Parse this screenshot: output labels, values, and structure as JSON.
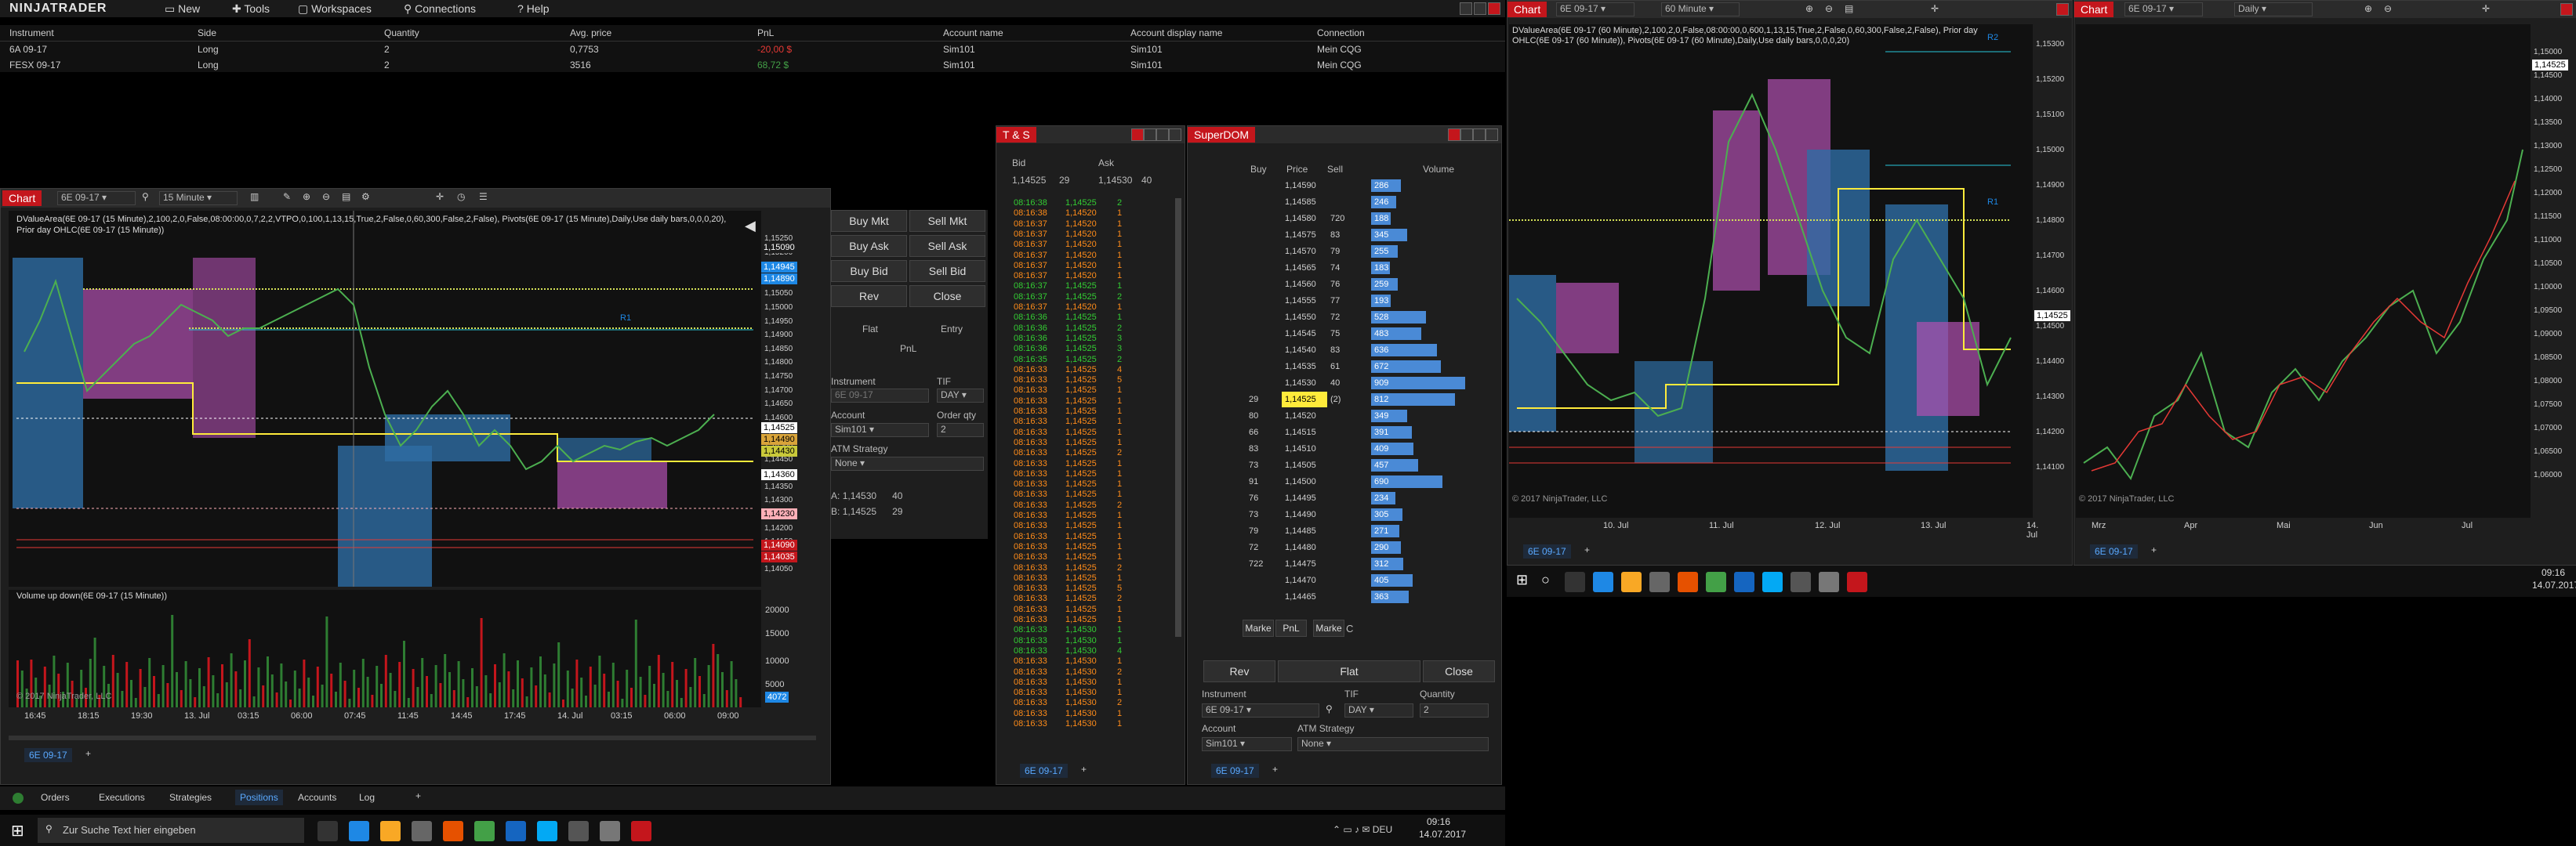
{
  "menubar": {
    "logo": "NINJATRADER",
    "items": [
      "New",
      "Tools",
      "Workspaces",
      "Connections",
      "Help"
    ]
  },
  "positions": {
    "headers": [
      "Instrument",
      "Side",
      "Quantity",
      "Avg. price",
      "PnL",
      "Account name",
      "Account display name",
      "Connection"
    ],
    "rows": [
      {
        "instrument": "6A 09-17",
        "side": "Long",
        "qty": "2",
        "avg": "0,7753",
        "pnl": "-20,00 $",
        "account": "Sim101",
        "display": "Sim101",
        "conn": "Mein CQG"
      },
      {
        "instrument": "FESX 09-17",
        "side": "Long",
        "qty": "2",
        "avg": "3516",
        "pnl": "68,72 $",
        "account": "Sim101",
        "display": "Sim101",
        "conn": "Mein CQG"
      }
    ]
  },
  "chart1": {
    "tab": "Chart",
    "instrument": "6E 09-17",
    "interval": "15 Minute",
    "info": "DValueArea(6E 09-17 (15 Minute),2,100,2,0,False,08:00:00,0,7,2,2,VTPO,0,100,1,13,15,True,2,False,0,60,300,False,2,False), Pivots(6E 09-17 (15 Minute),Daily,Use daily bars,0,0,0,20), Prior day OHLC(6E 09-17 (15 Minute))",
    "prices": [
      "1,15250",
      "1,15200",
      "1,15150",
      "1,15100",
      "1,15050",
      "1,15000",
      "1,14950",
      "1,14900",
      "1,14850",
      "1,14800",
      "1,14750",
      "1,14700",
      "1,14650",
      "1,14600",
      "1,14550",
      "1,14500",
      "1,14450",
      "1,14400",
      "1,14350",
      "1,14300",
      "1,14250",
      "1,14200",
      "1,14150",
      "1,14100",
      "1,14050"
    ],
    "tags": [
      {
        "text": "1,15090",
        "color": "#ffffff",
        "bg": "#1e1e1e"
      },
      {
        "text": "1,14945",
        "color": "#ffffff",
        "bg": "#1e88e5"
      },
      {
        "text": "1,14890",
        "color": "#ffffff",
        "bg": "#1e88e5"
      },
      {
        "text": "1,14525",
        "color": "#000000",
        "bg": "#ffffff"
      },
      {
        "text": "1,14490",
        "color": "#000000",
        "bg": "#d9a43a"
      },
      {
        "text": "1,14430",
        "color": "#000000",
        "bg": "#c9c93a"
      },
      {
        "text": "1,14360",
        "color": "#000000",
        "bg": "#ffffff"
      },
      {
        "text": "1,14230",
        "color": "#000000",
        "bg": "#ffb0b8"
      },
      {
        "text": "1,14090",
        "color": "#ffffff",
        "bg": "#c4161c"
      },
      {
        "text": "1,14035",
        "color": "#ffffff",
        "bg": "#c4161c"
      }
    ],
    "r1": "R1",
    "volume_label": "Volume up down(6E 09-17 (15 Minute))",
    "vol_ticks": [
      "20000",
      "15000",
      "10000",
      "5000"
    ],
    "vol_tag": "4072",
    "copyright": "© 2017 NinjaTrader, LLC",
    "xlabels": [
      "16:45",
      "18:15",
      "19:30",
      "13. Jul",
      "03:15",
      "06:00",
      "07:45",
      "11:45",
      "14:45",
      "17:45",
      "14. Jul",
      "03:15",
      "06:00",
      "09:00"
    ],
    "footer_tab": "6E 09-17"
  },
  "chart_trader": {
    "buttons": [
      "Buy Mkt",
      "Sell Mkt",
      "Buy Ask",
      "Sell Ask",
      "Buy Bid",
      "Sell Bid",
      "Rev",
      "Close"
    ],
    "flat": "Flat",
    "entry": "Entry",
    "pnl": "PnL",
    "instrument_label": "Instrument",
    "instrument": "6E 09-17",
    "tif_label": "TIF",
    "tif": "DAY",
    "account_label": "Account",
    "account": "Sim101",
    "qty_label": "Order qty",
    "qty": "2",
    "atm_label": "ATM Strategy",
    "atm": "None",
    "a_line": {
      "k": "A:",
      "p": "1,14530",
      "q": "40"
    },
    "b_line": {
      "k": "B:",
      "p": "1,14525",
      "q": "29"
    }
  },
  "ts": {
    "title": "T & S",
    "bid_label": "Bid",
    "ask_label": "Ask",
    "bid": "1,14525",
    "bidq": "29",
    "ask": "1,14530",
    "askq": "40",
    "rows": [
      [
        "08:16:38",
        "1,14525",
        "2",
        "g"
      ],
      [
        "08:16:38",
        "1,14520",
        "1",
        "o"
      ],
      [
        "08:16:37",
        "1,14520",
        "1",
        "o"
      ],
      [
        "08:16:37",
        "1,14520",
        "1",
        "o"
      ],
      [
        "08:16:37",
        "1,14520",
        "1",
        "o"
      ],
      [
        "08:16:37",
        "1,14520",
        "1",
        "o"
      ],
      [
        "08:16:37",
        "1,14520",
        "1",
        "o"
      ],
      [
        "08:16:37",
        "1,14520",
        "1",
        "o"
      ],
      [
        "08:16:37",
        "1,14525",
        "1",
        "g"
      ],
      [
        "08:16:37",
        "1,14525",
        "2",
        "g"
      ],
      [
        "08:16:37",
        "1,14520",
        "1",
        "o"
      ],
      [
        "08:16:36",
        "1,14525",
        "1",
        "g"
      ],
      [
        "08:16:36",
        "1,14525",
        "2",
        "g"
      ],
      [
        "08:16:36",
        "1,14525",
        "3",
        "g"
      ],
      [
        "08:16:36",
        "1,14525",
        "3",
        "g"
      ],
      [
        "08:16:35",
        "1,14525",
        "2",
        "g"
      ],
      [
        "08:16:33",
        "1,14525",
        "4",
        "o"
      ],
      [
        "08:16:33",
        "1,14525",
        "5",
        "o"
      ],
      [
        "08:16:33",
        "1,14525",
        "1",
        "o"
      ],
      [
        "08:16:33",
        "1,14525",
        "1",
        "o"
      ],
      [
        "08:16:33",
        "1,14525",
        "1",
        "o"
      ],
      [
        "08:16:33",
        "1,14525",
        "1",
        "o"
      ],
      [
        "08:16:33",
        "1,14525",
        "1",
        "o"
      ],
      [
        "08:16:33",
        "1,14525",
        "1",
        "o"
      ],
      [
        "08:16:33",
        "1,14525",
        "2",
        "o"
      ],
      [
        "08:16:33",
        "1,14525",
        "1",
        "o"
      ],
      [
        "08:16:33",
        "1,14525",
        "1",
        "o"
      ],
      [
        "08:16:33",
        "1,14525",
        "1",
        "o"
      ],
      [
        "08:16:33",
        "1,14525",
        "1",
        "o"
      ],
      [
        "08:16:33",
        "1,14525",
        "2",
        "o"
      ],
      [
        "08:16:33",
        "1,14525",
        "1",
        "o"
      ],
      [
        "08:16:33",
        "1,14525",
        "1",
        "o"
      ],
      [
        "08:16:33",
        "1,14525",
        "1",
        "o"
      ],
      [
        "08:16:33",
        "1,14525",
        "1",
        "o"
      ],
      [
        "08:16:33",
        "1,14525",
        "1",
        "o"
      ],
      [
        "08:16:33",
        "1,14525",
        "2",
        "o"
      ],
      [
        "08:16:33",
        "1,14525",
        "1",
        "o"
      ],
      [
        "08:16:33",
        "1,14525",
        "5",
        "o"
      ],
      [
        "08:16:33",
        "1,14525",
        "2",
        "o"
      ],
      [
        "08:16:33",
        "1,14525",
        "1",
        "o"
      ],
      [
        "08:16:33",
        "1,14525",
        "1",
        "o"
      ],
      [
        "08:16:33",
        "1,14530",
        "1",
        "g"
      ],
      [
        "08:16:33",
        "1,14530",
        "1",
        "g"
      ],
      [
        "08:16:33",
        "1,14530",
        "4",
        "g"
      ],
      [
        "08:16:33",
        "1,14530",
        "1",
        "o"
      ],
      [
        "08:16:33",
        "1,14530",
        "2",
        "o"
      ],
      [
        "08:16:33",
        "1,14530",
        "1",
        "o"
      ],
      [
        "08:16:33",
        "1,14530",
        "1",
        "o"
      ],
      [
        "08:16:33",
        "1,14530",
        "2",
        "o"
      ],
      [
        "08:16:33",
        "1,14530",
        "1",
        "o"
      ],
      [
        "08:16:33",
        "1,14530",
        "1",
        "o"
      ]
    ],
    "footer_tab": "6E 09-17"
  },
  "dom": {
    "title": "SuperDOM",
    "headers": [
      "Buy",
      "Price",
      "Sell",
      "Volume"
    ],
    "rows": [
      {
        "buy": "",
        "price": "1,14590",
        "sell": "",
        "vol": "286"
      },
      {
        "buy": "",
        "price": "1,14585",
        "sell": "",
        "vol": "246"
      },
      {
        "buy": "",
        "price": "1,14580",
        "sell": "720",
        "vol": "188"
      },
      {
        "buy": "",
        "price": "1,14575",
        "sell": "83",
        "vol": "345"
      },
      {
        "buy": "",
        "price": "1,14570",
        "sell": "79",
        "vol": "255"
      },
      {
        "buy": "",
        "price": "1,14565",
        "sell": "74",
        "vol": "183"
      },
      {
        "buy": "",
        "price": "1,14560",
        "sell": "76",
        "vol": "259"
      },
      {
        "buy": "",
        "price": "1,14555",
        "sell": "77",
        "vol": "193"
      },
      {
        "buy": "",
        "price": "1,14550",
        "sell": "72",
        "vol": "528"
      },
      {
        "buy": "",
        "price": "1,14545",
        "sell": "75",
        "vol": "483"
      },
      {
        "buy": "",
        "price": "1,14540",
        "sell": "83",
        "vol": "636"
      },
      {
        "buy": "",
        "price": "1,14535",
        "sell": "61",
        "vol": "672"
      },
      {
        "buy": "",
        "price": "1,14530",
        "sell": "40",
        "vol": "909"
      },
      {
        "buy": "29",
        "price": "1,14525",
        "sell": "(2)",
        "vol": "812"
      },
      {
        "buy": "80",
        "price": "1,14520",
        "sell": "",
        "vol": "349"
      },
      {
        "buy": "66",
        "price": "1,14515",
        "sell": "",
        "vol": "391"
      },
      {
        "buy": "83",
        "price": "1,14510",
        "sell": "",
        "vol": "409"
      },
      {
        "buy": "73",
        "price": "1,14505",
        "sell": "",
        "vol": "457"
      },
      {
        "buy": "91",
        "price": "1,14500",
        "sell": "",
        "vol": "690"
      },
      {
        "buy": "76",
        "price": "1,14495",
        "sell": "",
        "vol": "234"
      },
      {
        "buy": "73",
        "price": "1,14490",
        "sell": "",
        "vol": "305"
      },
      {
        "buy": "79",
        "price": "1,14485",
        "sell": "",
        "vol": "271"
      },
      {
        "buy": "72",
        "price": "1,14480",
        "sell": "",
        "vol": "290"
      },
      {
        "buy": "722",
        "price": "1,14475",
        "sell": "",
        "vol": "312"
      },
      {
        "buy": "",
        "price": "1,14470",
        "sell": "",
        "vol": "405"
      },
      {
        "buy": "",
        "price": "1,14465",
        "sell": "",
        "vol": "363"
      }
    ],
    "bottom": [
      "Marke",
      "PnL",
      "Marke",
      "C"
    ],
    "rev": "Rev",
    "flat": "Flat",
    "close": "Close",
    "instrument_label": "Instrument",
    "instrument": "6E 09-17",
    "tif_label": "TIF",
    "tif": "DAY",
    "qty_label": "Quantity",
    "qty": "2",
    "account_label": "Account",
    "account": "Sim101",
    "atm_label": "ATM Strategy",
    "atm": "None",
    "footer_tab": "6E 09-17"
  },
  "chart2": {
    "tab": "Chart",
    "instrument": "6E 09-17",
    "interval": "60 Minute",
    "info": "DValueArea(6E 09-17 (60 Minute),2,100,2,0,False,08:00:00,0,600,1,13,15,True,2,False,0,60,300,False,2,False), Prior day OHLC(6E 09-17 (60 Minute)), Pivots(6E 09-17 (60 Minute),Daily,Use daily bars,0,0,0,20)",
    "prices": [
      "1,15300",
      "1,15200",
      "1,15100",
      "1,15000",
      "1,14900",
      "1,14800",
      "1,14700",
      "1,14600",
      "1,14500",
      "1,14400",
      "1,14300",
      "1,14200",
      "1,14100"
    ],
    "tag": "1,14525",
    "r1": "R1",
    "r2": "R2",
    "xlabels": [
      "10. Jul",
      "11. Jul",
      "12. Jul",
      "13. Jul",
      "14. Jul"
    ],
    "copyright": "© 2017 NinjaTrader, LLC",
    "footer_tab": "6E 09-17"
  },
  "chart3": {
    "tab": "Chart",
    "instrument": "6E 09-17",
    "interval": "Daily",
    "prices": [
      "1,15000",
      "1,14500",
      "1,14000",
      "1,13500",
      "1,13000",
      "1,12500",
      "1,12000",
      "1,11500",
      "1,11000",
      "1,10500",
      "1,10000",
      "1,09500",
      "1,09000",
      "1,08500",
      "1,08000",
      "1,07500",
      "1,07000",
      "1,06500",
      "1,06000"
    ],
    "tag": "1,14525",
    "xlabels": [
      "Mrz",
      "Apr",
      "Mai",
      "Jun",
      "Jul"
    ],
    "copyright": "© 2017 NinjaTrader, LLC",
    "footer_tab": "6E 09-17"
  },
  "control_center_tabs": [
    "Orders",
    "Executions",
    "Strategies",
    "Positions",
    "Accounts",
    "Log"
  ],
  "taskbar": {
    "search": "Zur Suche Text hier eingeben",
    "time": "09:16",
    "date": "14.07.2017"
  },
  "taskbar2": {
    "time": "09:16",
    "date": "14.07.2017"
  },
  "colors": {
    "accent": "#c4161c",
    "buy": "#33cc33",
    "sell": "#ff8c1a",
    "profile": "#2e6da4",
    "magenta": "#b050b0"
  }
}
